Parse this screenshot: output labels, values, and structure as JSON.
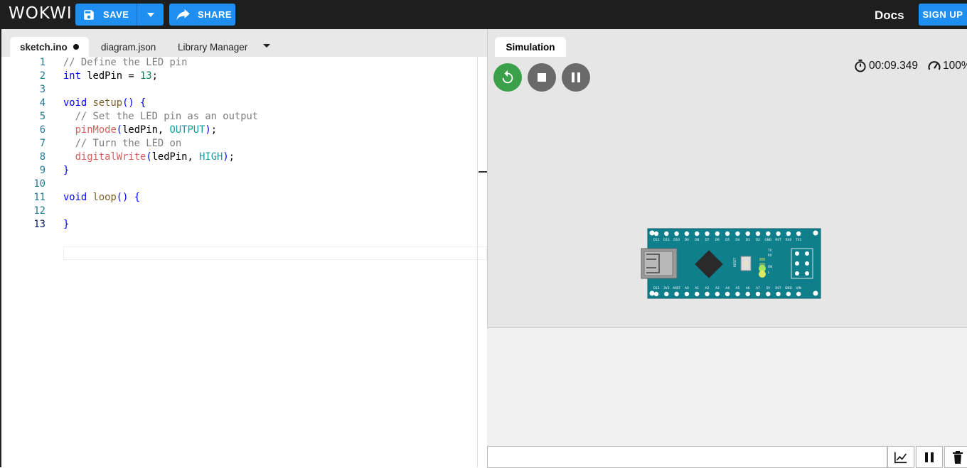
{
  "app": {
    "logo_text": "WOKWI"
  },
  "toolbar": {
    "save_label": "SAVE",
    "share_label": "SHARE",
    "docs_label": "Docs",
    "signup_label": "SIGN UP",
    "accent_color": "#1f8ef1"
  },
  "editor": {
    "tabs": [
      {
        "label": "sketch.ino",
        "modified": true
      },
      {
        "label": "diagram.json"
      },
      {
        "label": "Library Manager"
      }
    ],
    "lines": [
      {
        "n": "1",
        "text": "// Define the LED pin"
      },
      {
        "n": "2",
        "text": "int ledPin = 13;"
      },
      {
        "n": "3",
        "text": ""
      },
      {
        "n": "4",
        "text": "void setup() {"
      },
      {
        "n": "5",
        "text": "  // Set the LED pin as an output"
      },
      {
        "n": "6",
        "text": "  pinMode(ledPin, OUTPUT);"
      },
      {
        "n": "7",
        "text": "  // Turn the LED on"
      },
      {
        "n": "8",
        "text": "  digitalWrite(ledPin, HIGH);"
      },
      {
        "n": "9",
        "text": "}"
      },
      {
        "n": "10",
        "text": ""
      },
      {
        "n": "11",
        "text": "void loop() {"
      },
      {
        "n": "12",
        "text": ""
      },
      {
        "n": "13",
        "text": "}"
      }
    ]
  },
  "simulation": {
    "tab_label": "Simulation",
    "timer": "00:09.349",
    "speed": "100%",
    "board": {
      "top_pins": [
        "D12",
        "D11",
        "D10",
        "D9",
        "D8",
        "D7",
        "D6",
        "D5",
        "D4",
        "D3",
        "D2",
        "GND",
        "RST",
        "RX0",
        "TX1"
      ],
      "bottom_pins": [
        "D13",
        "3V3",
        "AREF",
        "A0",
        "A1",
        "A2",
        "A3",
        "A4",
        "A5",
        "A6",
        "A7",
        "5V",
        "RST",
        "GND",
        "VIN"
      ],
      "reset_label": "RESET",
      "led_labels": [
        "TX",
        "RX",
        "ON",
        "L"
      ]
    }
  }
}
